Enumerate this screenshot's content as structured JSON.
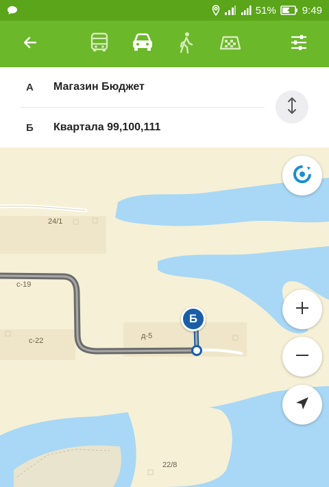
{
  "status_bar": {
    "battery_percent": "51%",
    "time": "9:49",
    "icons": [
      "chat-bubble-icon",
      "location-icon",
      "wifi-icon",
      "signal-icon",
      "battery-charging-icon"
    ]
  },
  "toolbar": {
    "icons": [
      "back-arrow-icon",
      "bus-icon",
      "car-icon",
      "walking-icon",
      "taxi-icon",
      "settings-sliders-icon"
    ],
    "selected_mode": "car",
    "background": "#6bb82a"
  },
  "route": {
    "origin": {
      "letter": "А",
      "name": "Магазин Бюджет"
    },
    "destination": {
      "letter": "Б",
      "name": "Квартала 99,100,111"
    }
  },
  "map": {
    "labels": {
      "l1": "24/1",
      "l2": "с-19",
      "l3": "с-22",
      "l4": "д-5",
      "l5": "22/8"
    },
    "destination_marker": "Б",
    "colors": {
      "land": "#f6f0d7",
      "water": "#a8d8f5",
      "route": "#7a7a7a",
      "marker": "#1b5ea8"
    },
    "controls": [
      "compass-icon",
      "zoom-in-icon",
      "zoom-out-icon",
      "my-location-icon"
    ]
  }
}
